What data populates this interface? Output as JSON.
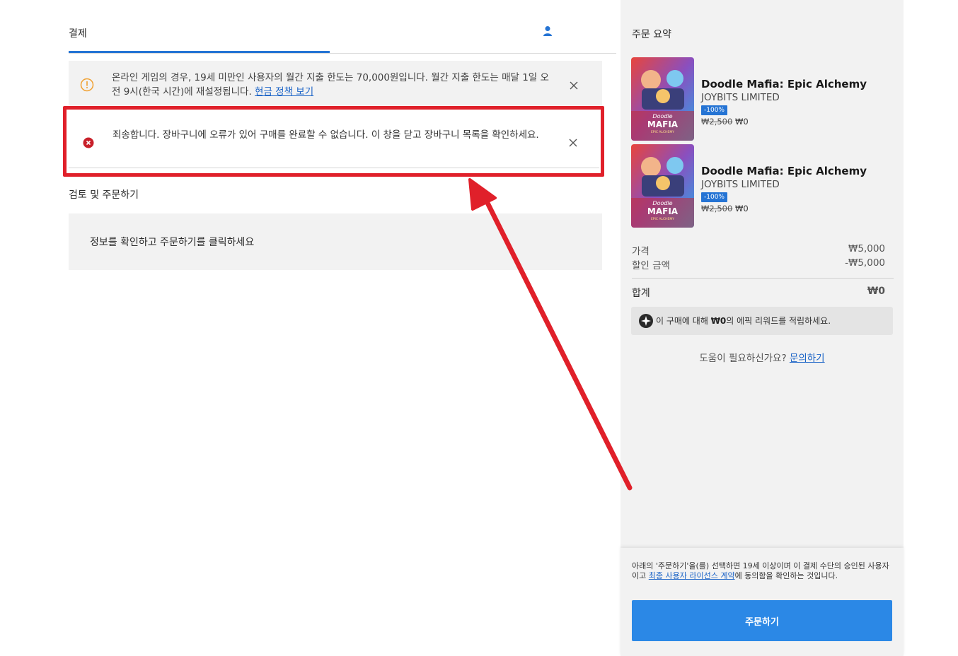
{
  "header": {
    "title": "결제"
  },
  "notice": {
    "text": "온라인 게임의 경우, 19세 미만인 사용자의 월간 지출 한도는 70,000원입니다. 월간 지출 한도는 매달 1일 오전 9시(한국 시간)에 재설정됩니다. ",
    "link": "현금 정책 보기"
  },
  "error": {
    "text": "죄송합니다. 장바구니에 오류가 있어 구매를 완료할 수 없습니다. 이 창을 닫고 장바구니 목록을 확인하세요."
  },
  "review": {
    "title": "검토 및 주문하기",
    "info": "정보를 확인하고 주문하기를 클릭하세요"
  },
  "summary": {
    "title": "주문 요약",
    "items": [
      {
        "name": "Doodle Mafia: Epic Alchemy",
        "publisher": "JOYBITS LIMITED",
        "discount": "-100%",
        "old_price": "₩2,500",
        "new_price": "₩0",
        "thumb_logo": "Doodle",
        "thumb_title": "MAFIA",
        "thumb_sub": "EPIC ALCHEMY"
      },
      {
        "name": "Doodle Mafia: Epic Alchemy",
        "publisher": "JOYBITS LIMITED",
        "discount": "-100%",
        "old_price": "₩2,500",
        "new_price": "₩0",
        "thumb_logo": "Doodle",
        "thumb_title": "MAFIA",
        "thumb_sub": "EPIC ALCHEMY"
      }
    ],
    "price_label": "가격",
    "price_value": "₩5,000",
    "discount_label": "할인 금액",
    "discount_value": "-₩5,000",
    "total_label": "합계",
    "total_value": "₩0",
    "reward_pre": "이 구매에 대해 ",
    "reward_amount": "₩0",
    "reward_post": "의 에픽 리워드를 적립하세요.",
    "help_text": "도움이 필요하신가요? ",
    "help_link": "문의하기"
  },
  "footer": {
    "legal_pre": "아래의 '주문하기'을(를) 선택하면 19세 이상이며 이 결제 수단의 승인된 사용자이고 ",
    "legal_link": "최종 사용자 라이선스 계약",
    "legal_post": "에 동의함을 확인하는 것입니다.",
    "order_button": "주문하기"
  },
  "colors": {
    "accent": "#2574d4",
    "button": "#2b88e6",
    "error": "#c8202a",
    "warning": "#f0a030",
    "annotation": "#e0202a"
  },
  "icons": {
    "user": "user-icon",
    "warning": "warning-circle-icon",
    "error": "error-circle-icon",
    "close": "close-icon",
    "reward": "epic-rewards-icon",
    "annotation_arrow": "red-arrow-annotation"
  }
}
